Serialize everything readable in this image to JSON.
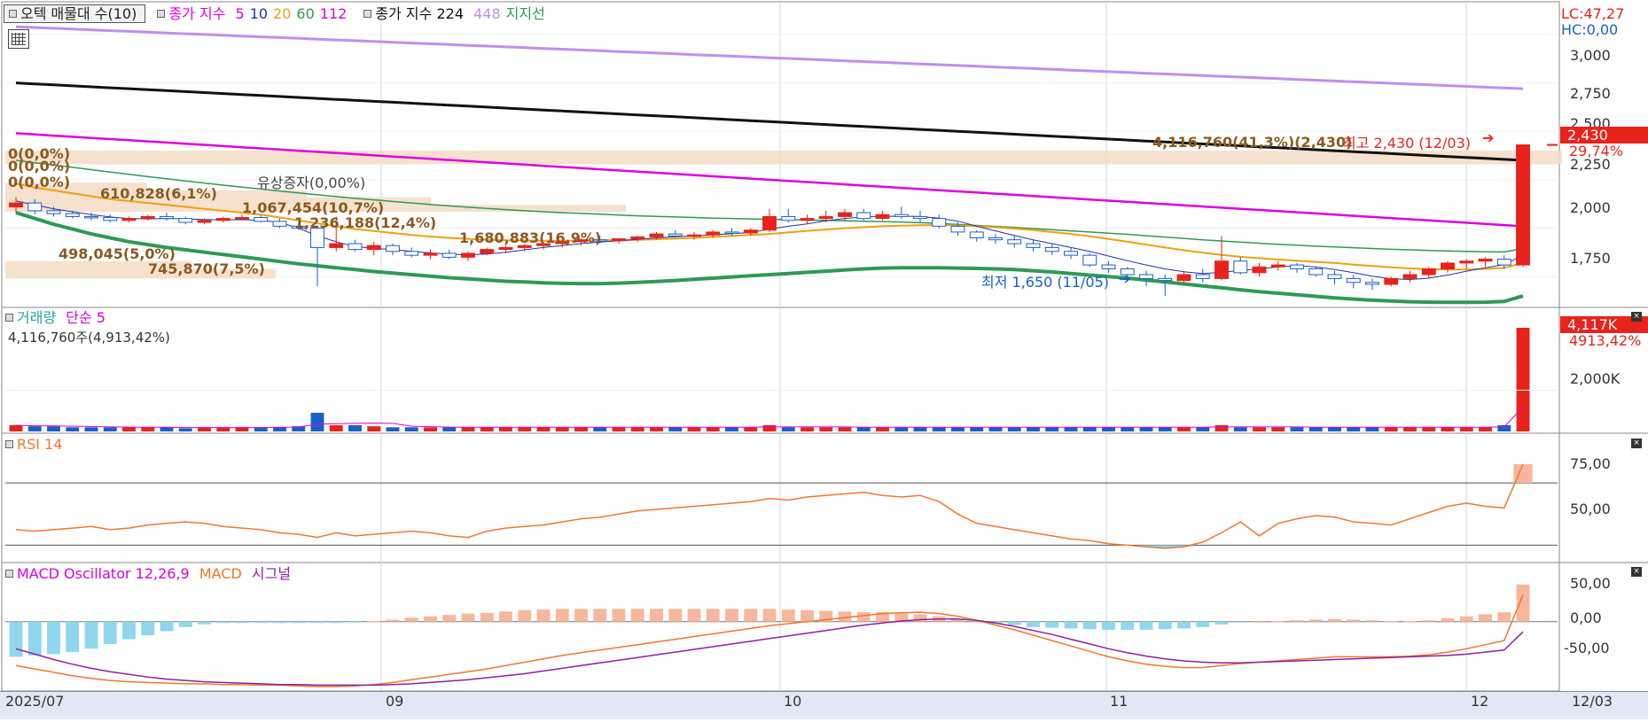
{
  "colors": {
    "up": "#e8231b",
    "down": "#1a5ec9",
    "ma5": "#e000e0",
    "ma10": "#2233aa",
    "ma20": "#f0a010",
    "ma60": "#2e9a55",
    "ma112": "#e000e0",
    "ma224": "#111111",
    "ma448": "#c08ef0",
    "support": "#2e9a55",
    "volume_profile": "#f3dcc4",
    "rsi": "#f07830",
    "macd": "#f07830",
    "signal": "#9020a0",
    "osc_pos": "#f6b79c",
    "osc_neg": "#8fd6ee",
    "axis_bg": "#dfe8f4"
  },
  "price_panel": {
    "header": {
      "volume_profile_label": "오텍 매물대 수(10)",
      "ma_label": "종가 지수",
      "ma_periods": [
        "5",
        "10",
        "20",
        "60",
        "112"
      ],
      "ma_long_label": "종가 지수 224",
      "ma_long_period": "448",
      "support_label": "지지선"
    },
    "icons": {
      "grid": "grid-table-icon"
    },
    "right_top": {
      "lc": "LC:47,27",
      "hc": "HC:0,00"
    },
    "y_ticks": [
      "3,000",
      "2,750",
      "2,500",
      "2,250",
      "2,000",
      "1,750"
    ],
    "current_price": "2,430",
    "current_change": "29,74%",
    "annotations": {
      "high": "최고 2,430 (12/03)",
      "high_volume": "4,116,760(41,3%)(2,430)",
      "low": "최저 1,650 (11/05)",
      "rights_issue": "유상증자(0,00%)",
      "vp_0a": "0(0,0%)",
      "vp_0b": "0(0,0%)",
      "vp_0c": "0(0,0%)",
      "vp_1": "610,828(6,1%)",
      "vp_2": "1,067,454(10,7%)",
      "vp_3": "1,236,188(12,4%)",
      "vp_4": "1,680,883(16,9%)",
      "vp_5": "498,045(5,0%)",
      "vp_6": "745,870(7,5%)"
    }
  },
  "volume_panel": {
    "label": "거래량",
    "ma_label": "단순 5",
    "current": "4,116,760주(4,913,42%)",
    "y_ticks": [
      "2,000K"
    ],
    "current_value": "4,117K",
    "current_pct": "4913,42%"
  },
  "rsi_panel": {
    "label": "RSI 14",
    "y_ticks": [
      "75,00",
      "50,00"
    ]
  },
  "macd_panel": {
    "label": "MACD Oscillator 12,26,9",
    "macd_label": "MACD",
    "signal_label": "시그널",
    "y_ticks": [
      "50,00",
      "0,00",
      "-50,00"
    ]
  },
  "x_axis": {
    "labels": [
      "2025/07",
      "09",
      "10",
      "11",
      "12"
    ],
    "end_label": "12/03"
  },
  "chart_data": {
    "type": "candlestick",
    "ylim": [
      1600,
      3050
    ],
    "candles": [
      [
        2110,
        2160,
        2080,
        2130
      ],
      [
        2130,
        2150,
        2070,
        2090
      ],
      [
        2090,
        2110,
        2060,
        2075
      ],
      [
        2075,
        2090,
        2050,
        2060
      ],
      [
        2060,
        2080,
        2040,
        2055
      ],
      [
        2055,
        2070,
        2030,
        2040
      ],
      [
        2040,
        2060,
        2030,
        2050
      ],
      [
        2050,
        2070,
        2040,
        2060
      ],
      [
        2060,
        2080,
        2040,
        2050
      ],
      [
        2050,
        2060,
        2020,
        2030
      ],
      [
        2030,
        2050,
        2020,
        2040
      ],
      [
        2040,
        2060,
        2030,
        2050
      ],
      [
        2050,
        2070,
        2040,
        2055
      ],
      [
        2055,
        2070,
        2030,
        2035
      ],
      [
        2035,
        2050,
        2000,
        2010
      ],
      [
        2010,
        2030,
        1990,
        2000
      ],
      [
        2000,
        2010,
        1700,
        1900
      ],
      [
        1900,
        2060,
        1880,
        1920
      ],
      [
        1920,
        1940,
        1880,
        1890
      ],
      [
        1890,
        1930,
        1860,
        1910
      ],
      [
        1910,
        1920,
        1860,
        1880
      ],
      [
        1880,
        1900,
        1850,
        1860
      ],
      [
        1860,
        1890,
        1840,
        1870
      ],
      [
        1870,
        1890,
        1840,
        1850
      ],
      [
        1850,
        1880,
        1830,
        1870
      ],
      [
        1870,
        1900,
        1860,
        1890
      ],
      [
        1890,
        1910,
        1870,
        1900
      ],
      [
        1900,
        1920,
        1880,
        1910
      ],
      [
        1910,
        1930,
        1890,
        1920
      ],
      [
        1920,
        1940,
        1900,
        1930
      ],
      [
        1930,
        1950,
        1910,
        1940
      ],
      [
        1940,
        1960,
        1920,
        1935
      ],
      [
        1935,
        1950,
        1920,
        1945
      ],
      [
        1945,
        1960,
        1930,
        1955
      ],
      [
        1955,
        1980,
        1940,
        1970
      ],
      [
        1970,
        1990,
        1950,
        1960
      ],
      [
        1960,
        1980,
        1940,
        1965
      ],
      [
        1965,
        1990,
        1950,
        1980
      ],
      [
        1980,
        2000,
        1960,
        1975
      ],
      [
        1975,
        2000,
        1960,
        1990
      ],
      [
        1990,
        2100,
        1980,
        2060
      ],
      [
        2060,
        2100,
        2030,
        2040
      ],
      [
        2040,
        2070,
        2020,
        2050
      ],
      [
        2050,
        2090,
        2030,
        2060
      ],
      [
        2060,
        2100,
        2040,
        2080
      ],
      [
        2080,
        2100,
        2040,
        2050
      ],
      [
        2050,
        2090,
        2040,
        2070
      ],
      [
        2070,
        2110,
        2050,
        2060
      ],
      [
        2060,
        2090,
        2030,
        2050
      ],
      [
        2050,
        2070,
        2000,
        2010
      ],
      [
        2010,
        2030,
        1960,
        1980
      ],
      [
        1980,
        1990,
        1930,
        1950
      ],
      [
        1950,
        1970,
        1920,
        1940
      ],
      [
        1940,
        1960,
        1900,
        1920
      ],
      [
        1920,
        1940,
        1880,
        1900
      ],
      [
        1900,
        1920,
        1860,
        1880
      ],
      [
        1880,
        1900,
        1840,
        1860
      ],
      [
        1860,
        1870,
        1800,
        1810
      ],
      [
        1810,
        1830,
        1770,
        1790
      ],
      [
        1790,
        1800,
        1740,
        1760
      ],
      [
        1760,
        1780,
        1700,
        1740
      ],
      [
        1740,
        1760,
        1650,
        1730
      ],
      [
        1730,
        1780,
        1710,
        1760
      ],
      [
        1760,
        1790,
        1720,
        1740
      ],
      [
        1740,
        1960,
        1730,
        1830
      ],
      [
        1830,
        1850,
        1760,
        1770
      ],
      [
        1770,
        1820,
        1750,
        1800
      ],
      [
        1800,
        1830,
        1780,
        1810
      ],
      [
        1810,
        1820,
        1770,
        1790
      ],
      [
        1790,
        1800,
        1750,
        1760
      ],
      [
        1760,
        1780,
        1710,
        1740
      ],
      [
        1740,
        1760,
        1690,
        1720
      ],
      [
        1720,
        1740,
        1680,
        1710
      ],
      [
        1710,
        1750,
        1700,
        1740
      ],
      [
        1740,
        1780,
        1720,
        1760
      ],
      [
        1760,
        1800,
        1740,
        1790
      ],
      [
        1790,
        1830,
        1770,
        1820
      ],
      [
        1820,
        1840,
        1790,
        1830
      ],
      [
        1830,
        1850,
        1800,
        1840
      ],
      [
        1840,
        1860,
        1790,
        1810
      ],
      [
        1810,
        2430,
        1800,
        2430
      ]
    ],
    "ma5": [
      2140,
      2120,
      2100,
      2085,
      2070,
      2058,
      2050,
      2048,
      2050,
      2048,
      2045,
      2043,
      2044,
      2040,
      2030,
      2000,
      1960,
      1930,
      1905,
      1895,
      1890,
      1880,
      1872,
      1866,
      1862,
      1866,
      1875,
      1888,
      1900,
      1910,
      1920,
      1928,
      1935,
      1942,
      1950,
      1956,
      1960,
      1966,
      1972,
      1978,
      1995,
      2010,
      2022,
      2038,
      2050,
      2058,
      2060,
      2062,
      2060,
      2052,
      2036,
      2010,
      1986,
      1962,
      1940,
      1920,
      1900,
      1880,
      1856,
      1832,
      1810,
      1790,
      1775,
      1765,
      1772,
      1782,
      1790,
      1800,
      1806,
      1800,
      1786,
      1770,
      1752,
      1738,
      1735,
      1742,
      1758,
      1778,
      1796,
      1812,
      1860
    ],
    "ma20": [
      2230,
      2210,
      2195,
      2180,
      2165,
      2150,
      2140,
      2130,
      2120,
      2110,
      2100,
      2090,
      2080,
      2070,
      2055,
      2040,
      2025,
      2010,
      1995,
      1985,
      1975,
      1965,
      1957,
      1950,
      1945,
      1940,
      1938,
      1936,
      1935,
      1935,
      1936,
      1937,
      1938,
      1940,
      1943,
      1946,
      1950,
      1955,
      1960,
      1965,
      1970,
      1978,
      1986,
      1993,
      2000,
      2005,
      2010,
      2013,
      2015,
      2016,
      2014,
      2010,
      2005,
      1998,
      1990,
      1980,
      1970,
      1958,
      1944,
      1930,
      1915,
      1900,
      1886,
      1873,
      1862,
      1852,
      1845,
      1838,
      1832,
      1826,
      1820,
      1812,
      1805,
      1798,
      1792,
      1788,
      1786,
      1786,
      1790,
      1795,
      1820
    ],
    "ma60": [
      2350,
      2338,
      2326,
      2314,
      2302,
      2290,
      2278,
      2266,
      2255,
      2244,
      2233,
      2222,
      2212,
      2202,
      2192,
      2182,
      2172,
      2163,
      2154,
      2146,
      2138,
      2130,
      2122,
      2115,
      2108,
      2102,
      2096,
      2090,
      2085,
      2080,
      2076,
      2072,
      2068,
      2064,
      2061,
      2058,
      2055,
      2052,
      2050,
      2048,
      2046,
      2044,
      2042,
      2040,
      2038,
      2036,
      2034,
      2032,
      2028,
      2024,
      2019,
      2014,
      2009,
      2004,
      1998,
      1992,
      1986,
      1980,
      1974,
      1968,
      1961,
      1954,
      1947,
      1940,
      1934,
      1928,
      1922,
      1917,
      1912,
      1907,
      1903,
      1899,
      1895,
      1891,
      1888,
      1885,
      1882,
      1880,
      1878,
      1877,
      1895
    ],
    "ma112": [
      2490,
      2484,
      2478,
      2472,
      2466,
      2460,
      2454,
      2448,
      2442,
      2436,
      2430,
      2424,
      2418,
      2412,
      2406,
      2400,
      2394,
      2388,
      2382,
      2376,
      2370,
      2364,
      2358,
      2352,
      2346,
      2340,
      2334,
      2328,
      2322,
      2316,
      2310,
      2304,
      2298,
      2292,
      2286,
      2280,
      2274,
      2268,
      2262,
      2256,
      2250,
      2244,
      2238,
      2232,
      2226,
      2220,
      2214,
      2208,
      2202,
      2196,
      2190,
      2184,
      2178,
      2172,
      2166,
      2160,
      2154,
      2148,
      2142,
      2136,
      2130,
      2124,
      2118,
      2112,
      2106,
      2100,
      2094,
      2088,
      2082,
      2076,
      2070,
      2064,
      2058,
      2052,
      2046,
      2040,
      2034,
      2028,
      2022,
      2016,
      2010
    ],
    "ma224": [
      2750,
      2745,
      2740,
      2735,
      2730,
      2725,
      2720,
      2715,
      2710,
      2705,
      2700,
      2695,
      2690,
      2685,
      2680,
      2675,
      2670,
      2665,
      2660,
      2655,
      2650,
      2645,
      2640,
      2635,
      2630,
      2625,
      2620,
      2615,
      2610,
      2605,
      2600,
      2595,
      2590,
      2585,
      2580,
      2575,
      2570,
      2565,
      2560,
      2555,
      2550,
      2545,
      2540,
      2535,
      2530,
      2525,
      2520,
      2515,
      2510,
      2505,
      2500,
      2495,
      2490,
      2485,
      2480,
      2475,
      2470,
      2465,
      2460,
      2455,
      2450,
      2445,
      2440,
      2435,
      2430,
      2425,
      2420,
      2415,
      2410,
      2405,
      2400,
      2395,
      2390,
      2385,
      2380,
      2375,
      2370,
      2365,
      2360,
      2355,
      2350
    ],
    "ma448": [
      3040,
      3036,
      3032,
      3028,
      3024,
      3020,
      3016,
      3012,
      3008,
      3004,
      3000,
      2996,
      2992,
      2988,
      2984,
      2980,
      2976,
      2972,
      2968,
      2964,
      2960,
      2956,
      2952,
      2948,
      2944,
      2940,
      2936,
      2932,
      2928,
      2924,
      2920,
      2916,
      2912,
      2908,
      2904,
      2900,
      2896,
      2892,
      2888,
      2884,
      2880,
      2876,
      2872,
      2868,
      2864,
      2860,
      2856,
      2852,
      2848,
      2844,
      2840,
      2836,
      2832,
      2828,
      2824,
      2820,
      2816,
      2812,
      2808,
      2804,
      2800,
      2796,
      2792,
      2788,
      2784,
      2780,
      2776,
      2772,
      2768,
      2764,
      2760,
      2756,
      2752,
      2748,
      2744,
      2740,
      2736,
      2732,
      2728,
      2724,
      2720
    ],
    "support": [
      2080,
      2050,
      2020,
      1995,
      1970,
      1950,
      1930,
      1915,
      1900,
      1888,
      1876,
      1864,
      1852,
      1840,
      1828,
      1816,
      1806,
      1796,
      1786,
      1776,
      1768,
      1760,
      1752,
      1744,
      1738,
      1732,
      1726,
      1722,
      1718,
      1715,
      1714,
      1714,
      1716,
      1720,
      1725,
      1730,
      1736,
      1742,
      1748,
      1754,
      1760,
      1766,
      1772,
      1778,
      1784,
      1790,
      1794,
      1796,
      1796,
      1796,
      1794,
      1792,
      1790,
      1786,
      1780,
      1774,
      1766,
      1758,
      1750,
      1742,
      1732,
      1722,
      1712,
      1702,
      1692,
      1682,
      1672,
      1664,
      1656,
      1648,
      1640,
      1634,
      1628,
      1624,
      1620,
      1618,
      1617,
      1617,
      1618,
      1622,
      1650
    ],
    "volume": [
      0.06,
      0.05,
      0.05,
      0.04,
      0.04,
      0.04,
      0.04,
      0.04,
      0.04,
      0.03,
      0.04,
      0.04,
      0.04,
      0.04,
      0.04,
      0.05,
      0.18,
      0.06,
      0.06,
      0.05,
      0.04,
      0.04,
      0.04,
      0.04,
      0.04,
      0.04,
      0.04,
      0.04,
      0.04,
      0.04,
      0.04,
      0.04,
      0.04,
      0.04,
      0.04,
      0.04,
      0.04,
      0.04,
      0.04,
      0.04,
      0.06,
      0.04,
      0.04,
      0.04,
      0.04,
      0.04,
      0.04,
      0.04,
      0.04,
      0.04,
      0.04,
      0.04,
      0.04,
      0.04,
      0.04,
      0.04,
      0.04,
      0.04,
      0.04,
      0.04,
      0.04,
      0.04,
      0.04,
      0.04,
      0.06,
      0.04,
      0.04,
      0.04,
      0.04,
      0.04,
      0.04,
      0.04,
      0.04,
      0.04,
      0.04,
      0.04,
      0.04,
      0.04,
      0.04,
      0.06,
      1.0
    ],
    "rsi": [
      40,
      39,
      40,
      41,
      42,
      40,
      41,
      43,
      44,
      45,
      44,
      42,
      41,
      40,
      38,
      37,
      35,
      38,
      36,
      37,
      38,
      39,
      38,
      36,
      35,
      39,
      41,
      42,
      43,
      45,
      47,
      48,
      50,
      52,
      53,
      54,
      55,
      56,
      57,
      58,
      60,
      59,
      61,
      62,
      63,
      64,
      62,
      61,
      62,
      58,
      50,
      44,
      42,
      40,
      38,
      36,
      34,
      33,
      31,
      30,
      29,
      28,
      29,
      32,
      38,
      45,
      36,
      44,
      47,
      49,
      48,
      45,
      44,
      43,
      47,
      51,
      55,
      57,
      55,
      54,
      82
    ],
    "macd": [
      -65,
      -70,
      -75,
      -80,
      -84,
      -87,
      -89,
      -90,
      -91,
      -92,
      -92,
      -93,
      -93,
      -94,
      -94,
      -95,
      -96,
      -96,
      -95,
      -93,
      -90,
      -86,
      -82,
      -78,
      -74,
      -70,
      -65,
      -60,
      -55,
      -50,
      -46,
      -42,
      -38,
      -34,
      -30,
      -26,
      -22,
      -18,
      -14,
      -10,
      -6,
      -3,
      0,
      3,
      6,
      9,
      12,
      13,
      14,
      12,
      8,
      2,
      -5,
      -12,
      -20,
      -28,
      -36,
      -44,
      -52,
      -58,
      -63,
      -66,
      -68,
      -68,
      -65,
      -62,
      -60,
      -58,
      -56,
      -54,
      -52,
      -52,
      -52,
      -52,
      -51,
      -49,
      -45,
      -40,
      -34,
      -28,
      40
    ],
    "signal": [
      -40,
      -48,
      -56,
      -63,
      -69,
      -74,
      -78,
      -82,
      -85,
      -87,
      -89,
      -90,
      -91,
      -92,
      -93,
      -93,
      -94,
      -94,
      -94,
      -94,
      -93,
      -92,
      -90,
      -88,
      -86,
      -83,
      -80,
      -77,
      -73,
      -69,
      -65,
      -61,
      -57,
      -53,
      -49,
      -45,
      -41,
      -37,
      -33,
      -29,
      -25,
      -21,
      -17,
      -13,
      -9,
      -5,
      -2,
      1,
      3,
      4,
      4,
      2,
      -2,
      -7,
      -13,
      -19,
      -26,
      -33,
      -40,
      -46,
      -51,
      -55,
      -58,
      -60,
      -61,
      -61,
      -60,
      -59,
      -58,
      -57,
      -56,
      -55,
      -54,
      -53,
      -52,
      -51,
      -50,
      -48,
      -45,
      -42,
      -15
    ],
    "osc": [
      -52,
      -50,
      -48,
      -45,
      -40,
      -33,
      -26,
      -20,
      -14,
      -8,
      -4,
      -2,
      -2,
      -2,
      -2,
      -2,
      -2,
      -2,
      -1,
      1,
      3,
      6,
      8,
      10,
      12,
      13,
      15,
      17,
      18,
      19,
      19,
      19,
      19,
      19,
      19,
      19,
      19,
      19,
      19,
      19,
      19,
      18,
      17,
      16,
      15,
      14,
      14,
      12,
      11,
      8,
      4,
      0,
      -3,
      -5,
      -8,
      -9,
      -10,
      -11,
      -12,
      -12,
      -12,
      -11,
      -10,
      -8,
      -4,
      -1,
      0,
      1,
      2,
      3,
      4,
      3,
      2,
      1,
      1,
      2,
      5,
      8,
      11,
      14,
      55
    ]
  }
}
